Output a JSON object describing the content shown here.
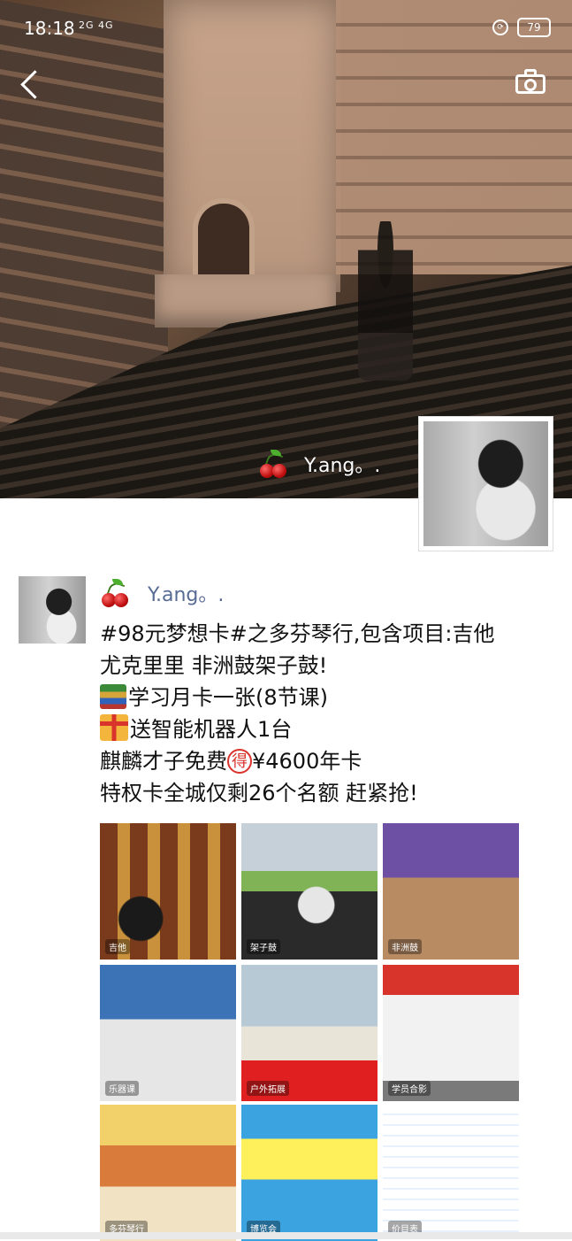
{
  "status_bar": {
    "time": "18:18",
    "signal": "2G 4G",
    "battery": "79"
  },
  "cover": {
    "name": "Y.ang。."
  },
  "post": {
    "name": "Y.ang。.",
    "lines": [
      "#98元梦想卡#之多芬琴行,包含项目:吉他",
      "尤克里里 非洲鼓架子鼓!",
      "学习月卡一张(8节课)",
      "送智能机器人1台",
      "麒麟才子免费",
      "¥4600年卡",
      "特权卡全城仅剩26个名额 赶紧抢!"
    ],
    "circled_char": "得"
  },
  "images": {
    "labels": [
      "吉他",
      "架子鼓",
      "非洲鼓",
      "乐器课",
      "户外拓展",
      "学员合影",
      "多芬琴行",
      "博览会",
      "价目表"
    ]
  },
  "icons": {
    "back": "chevron-left-icon",
    "camera": "camera-icon",
    "cherries": "cherry-emoji",
    "books": "books-emoji",
    "gift": "gift-emoji"
  },
  "colors": {
    "link": "#576b95",
    "text": "#111111",
    "accent_red": "#d9342c"
  }
}
